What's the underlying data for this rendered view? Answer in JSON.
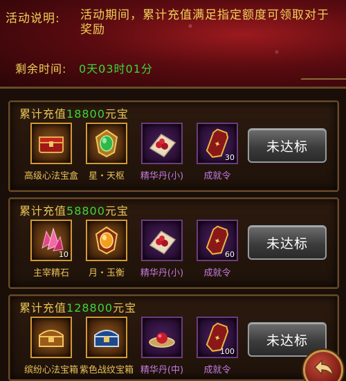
{
  "header": {
    "desc_label": "活动说明:",
    "desc_text": "活动期间，累计充值满足指定额度可领取对于奖励",
    "time_label": "剩余时间:",
    "time_value": "0天03时01分"
  },
  "tiers": [
    {
      "title_prefix": "累计充值",
      "amount": "18800",
      "title_suffix": "元宝",
      "button_label": "未达标",
      "items": [
        {
          "name": "高级心法宝盒",
          "icon": "red-treasure-box-icon",
          "count": ""
        },
        {
          "name": "星・天枢",
          "icon": "green-gem-amulet-icon",
          "count": ""
        },
        {
          "name": "精华丹(小)",
          "icon": "essence-pill-icon",
          "count": ""
        },
        {
          "name": "成就令",
          "icon": "achievement-token-icon",
          "count": "30"
        }
      ]
    },
    {
      "title_prefix": "累计充值",
      "amount": "58800",
      "title_suffix": "元宝",
      "button_label": "未达标",
      "items": [
        {
          "name": "主宰精石",
          "icon": "pink-crystal-icon",
          "count": "10"
        },
        {
          "name": "月・玉衡",
          "icon": "gold-amulet-icon",
          "count": ""
        },
        {
          "name": "精华丹(小)",
          "icon": "essence-pill-icon",
          "count": ""
        },
        {
          "name": "成就令",
          "icon": "achievement-token-icon",
          "count": "60"
        }
      ]
    },
    {
      "title_prefix": "累计充值",
      "amount": "128800",
      "title_suffix": "元宝",
      "button_label": "未达标",
      "items": [
        {
          "name": "缤纷心法宝箱",
          "icon": "treasure-chest-icon",
          "count": ""
        },
        {
          "name": "紫色战纹宝箱",
          "icon": "blue-chest-icon",
          "count": ""
        },
        {
          "name": "精华丹(中)",
          "icon": "essence-pill-large-icon",
          "count": ""
        },
        {
          "name": "成就令",
          "icon": "achievement-token-icon",
          "count": "100"
        }
      ]
    }
  ],
  "colors": {
    "gold_text": "#f2d25a",
    "green_text": "#3cd63c",
    "purple_text": "#c57ae0"
  }
}
